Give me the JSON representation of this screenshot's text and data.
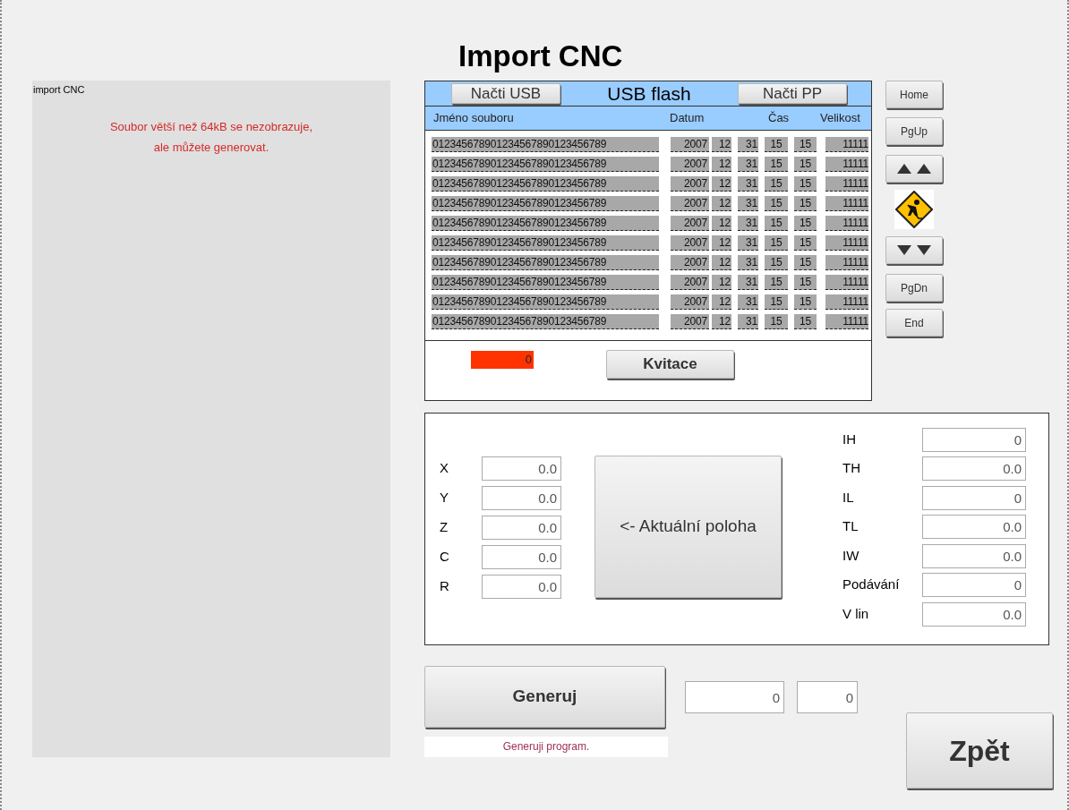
{
  "title": "Import CNC",
  "left_panel": {
    "caption": "import CNC",
    "message_lines": [
      "Soubor větší než 64kB se nezobrazuje,",
      "ale můžete generovat."
    ]
  },
  "file_browser": {
    "load_usb_button": "Načti USB",
    "source_title": "USB flash",
    "load_pp_button": "Načti PP",
    "columns": [
      "Jméno souboru",
      "Datum",
      "Čas",
      "Velikost"
    ],
    "rows": [
      {
        "name": "012345678901234567890123456789",
        "year": "2007",
        "month": "12",
        "day": "31",
        "hour": "15",
        "minute": "15",
        "size": "11111"
      },
      {
        "name": "012345678901234567890123456789",
        "year": "2007",
        "month": "12",
        "day": "31",
        "hour": "15",
        "minute": "15",
        "size": "11111"
      },
      {
        "name": "012345678901234567890123456789",
        "year": "2007",
        "month": "12",
        "day": "31",
        "hour": "15",
        "minute": "15",
        "size": "11111"
      },
      {
        "name": "012345678901234567890123456789",
        "year": "2007",
        "month": "12",
        "day": "31",
        "hour": "15",
        "minute": "15",
        "size": "11111"
      },
      {
        "name": "012345678901234567890123456789",
        "year": "2007",
        "month": "12",
        "day": "31",
        "hour": "15",
        "minute": "15",
        "size": "11111"
      },
      {
        "name": "012345678901234567890123456789",
        "year": "2007",
        "month": "12",
        "day": "31",
        "hour": "15",
        "minute": "15",
        "size": "11111"
      },
      {
        "name": "012345678901234567890123456789",
        "year": "2007",
        "month": "12",
        "day": "31",
        "hour": "15",
        "minute": "15",
        "size": "11111"
      },
      {
        "name": "012345678901234567890123456789",
        "year": "2007",
        "month": "12",
        "day": "31",
        "hour": "15",
        "minute": "15",
        "size": "11111"
      },
      {
        "name": "012345678901234567890123456789",
        "year": "2007",
        "month": "12",
        "day": "31",
        "hour": "15",
        "minute": "15",
        "size": "11111"
      },
      {
        "name": "012345678901234567890123456789",
        "year": "2007",
        "month": "12",
        "day": "31",
        "hour": "15",
        "minute": "15",
        "size": "11111"
      }
    ],
    "error_indicator": "0",
    "ack_button": "Kvitace"
  },
  "nav_buttons": [
    {
      "kind": "text",
      "label": "Home"
    },
    {
      "kind": "text",
      "label": "PgUp"
    },
    {
      "kind": "up"
    },
    {
      "kind": "sign"
    },
    {
      "kind": "down"
    },
    {
      "kind": "text",
      "label": "PgDn"
    },
    {
      "kind": "text",
      "label": "End"
    }
  ],
  "axes": [
    {
      "label": "X",
      "value": "0.0"
    },
    {
      "label": "Y",
      "value": "0.0"
    },
    {
      "label": "Z",
      "value": "0.0"
    },
    {
      "label": "C",
      "value": "0.0"
    },
    {
      "label": "R",
      "value": "0.0"
    }
  ],
  "current_position_button": "<- Aktuální poloha",
  "tool_params": [
    {
      "label": "IH",
      "value": "0"
    },
    {
      "label": "TH",
      "value": "0.0"
    },
    {
      "label": "IL",
      "value": "0"
    },
    {
      "label": "TL",
      "value": "0.0"
    },
    {
      "label": "IW",
      "value": "0.0"
    },
    {
      "label": "Podávání",
      "value": "0"
    },
    {
      "label": "V lin",
      "value": "0.0"
    }
  ],
  "generate_button": "Generuj",
  "counters": [
    "0",
    "0"
  ],
  "status": "Generuji program.",
  "back_button": "Zpět"
}
